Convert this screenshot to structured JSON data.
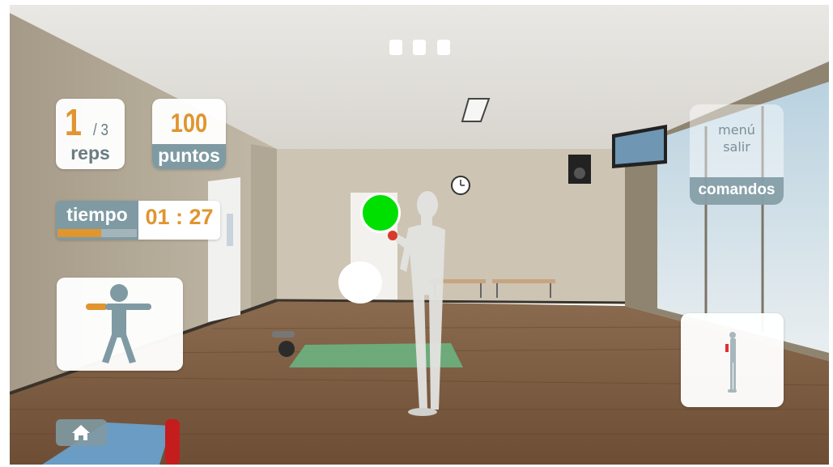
{
  "hud": {
    "reps": {
      "current": "1",
      "total": "/ 3",
      "label": "reps"
    },
    "points": {
      "value": "100",
      "label": "puntos"
    },
    "time": {
      "label": "tiempo",
      "value": "01 : 27",
      "progress_fraction": 0.55
    },
    "commands": {
      "menu_label": "menú",
      "exit_label": "salir",
      "title": "comandos"
    },
    "exercise_icon": "arms-extended-figure-icon",
    "preview_icon": "standing-figure-preview-icon",
    "home_icon": "home-icon"
  },
  "colors": {
    "accent_orange": "#e0952f",
    "panel_slate": "#7f9aa3",
    "target_green": "#00e000",
    "text_slate": "#6a7c82"
  }
}
